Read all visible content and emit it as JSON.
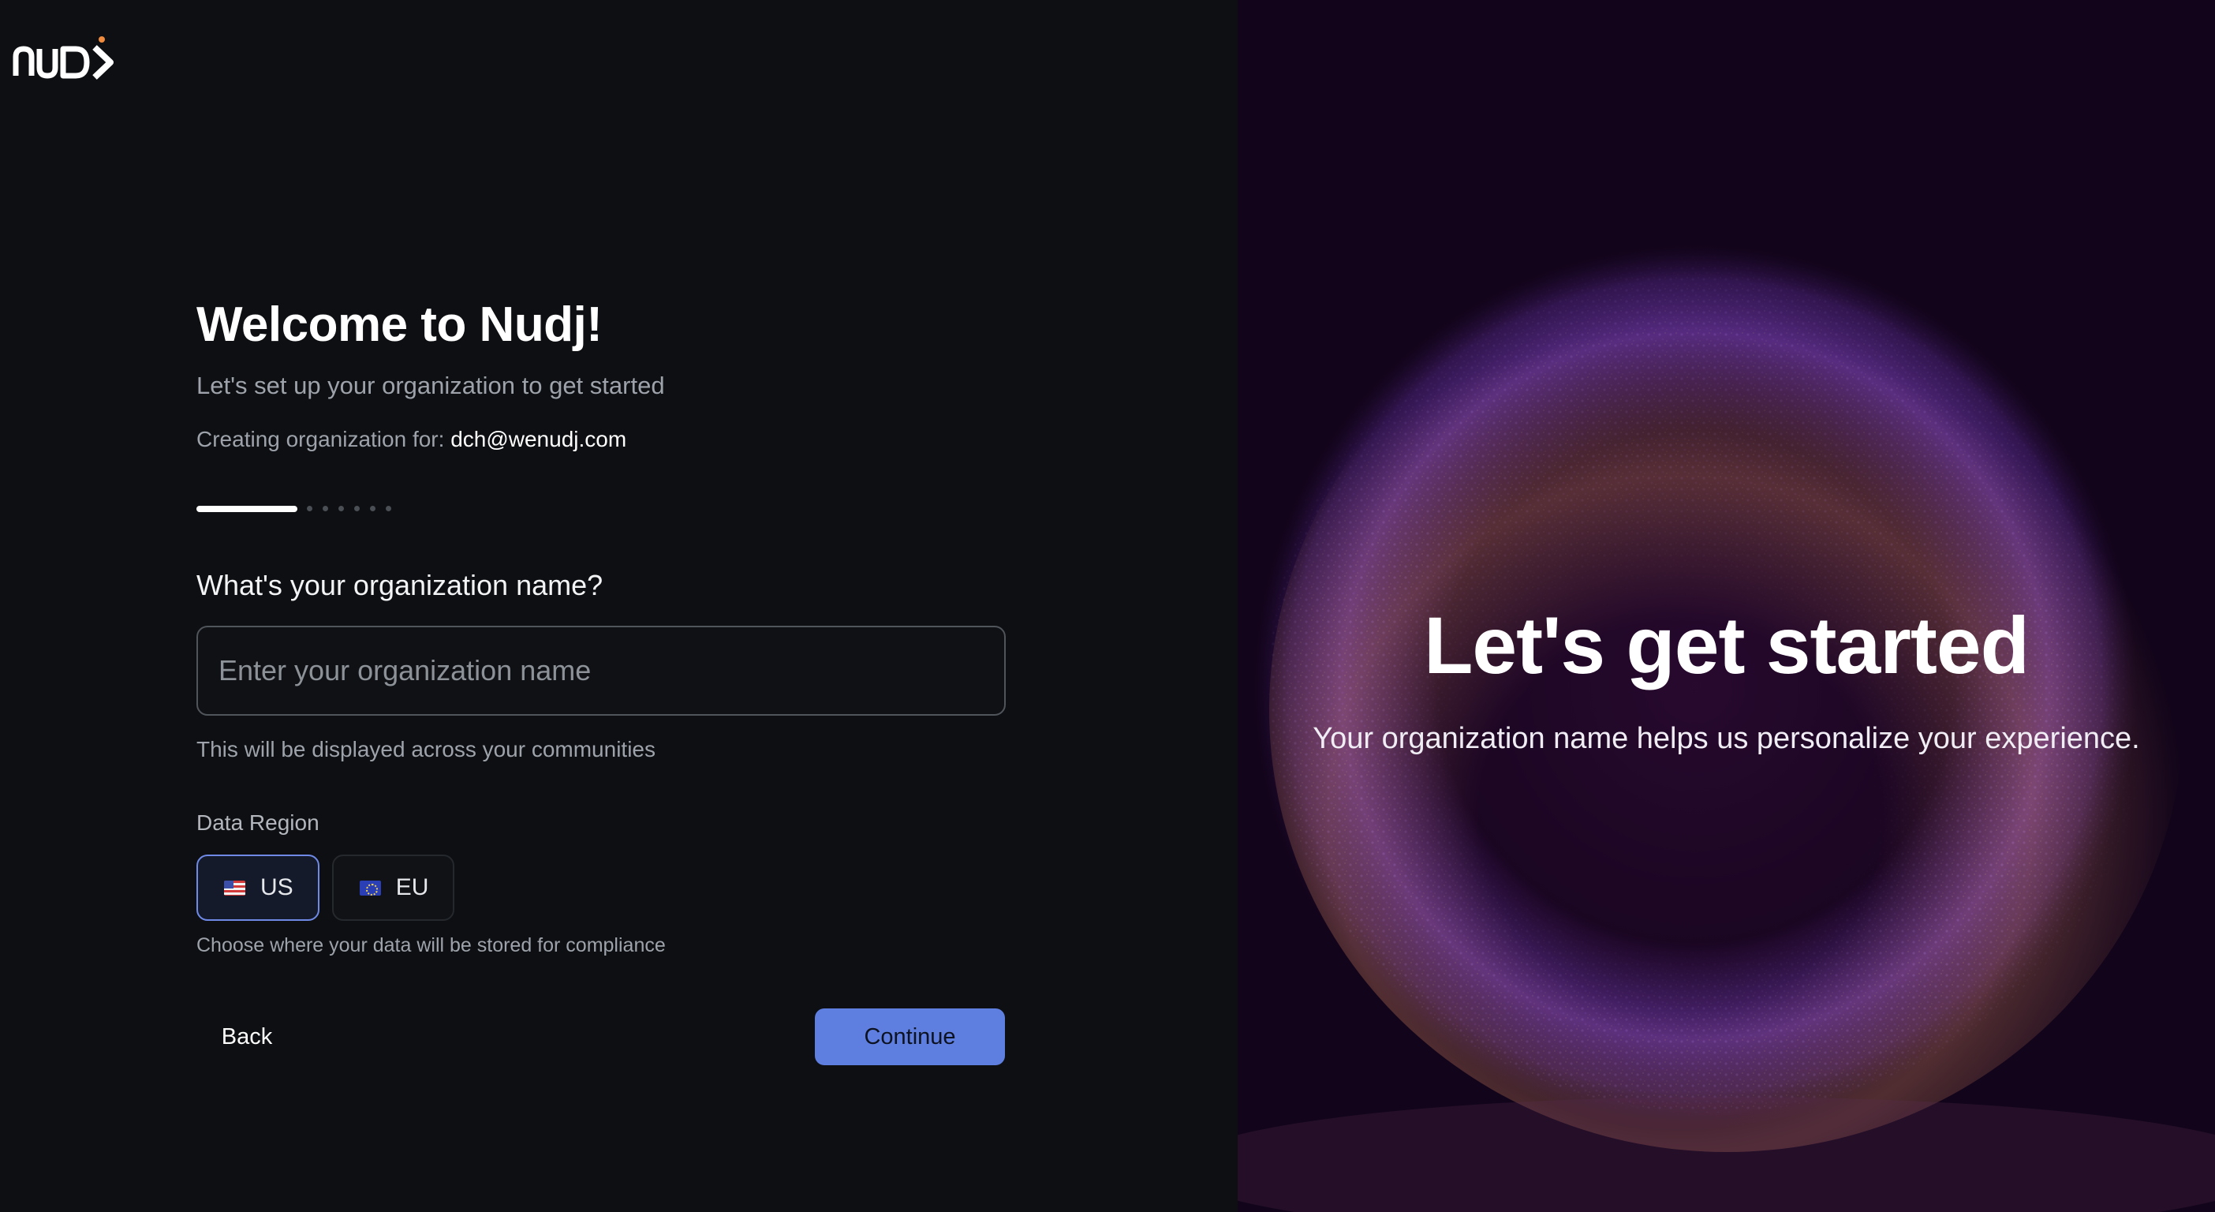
{
  "brand": {
    "logo_text": "nudj",
    "accent_color": "#f08a3c"
  },
  "onboarding": {
    "title": "Welcome to Nudj!",
    "subtitle": "Let's set up your organization to get started",
    "creating_label": "Creating organization for:",
    "creating_email": "dch@wenudj.com",
    "progress": {
      "current_step": 1,
      "total_steps": 7
    },
    "question": "What's your organization name?",
    "org_input": {
      "value": "",
      "placeholder": "Enter your organization name"
    },
    "input_hint": "This will be displayed across your communities",
    "region": {
      "label": "Data Region",
      "selected": "US",
      "options": [
        {
          "code": "US",
          "flag": "us-flag-icon"
        },
        {
          "code": "EU",
          "flag": "eu-flag-icon"
        }
      ],
      "hint": "Choose where your data will be stored for compliance"
    },
    "back_label": "Back",
    "continue_label": "Continue",
    "continue_color": "#5f7fe0"
  },
  "hero": {
    "title": "Let's get started",
    "subtitle": "Your organization name helps us personalize your experience."
  }
}
